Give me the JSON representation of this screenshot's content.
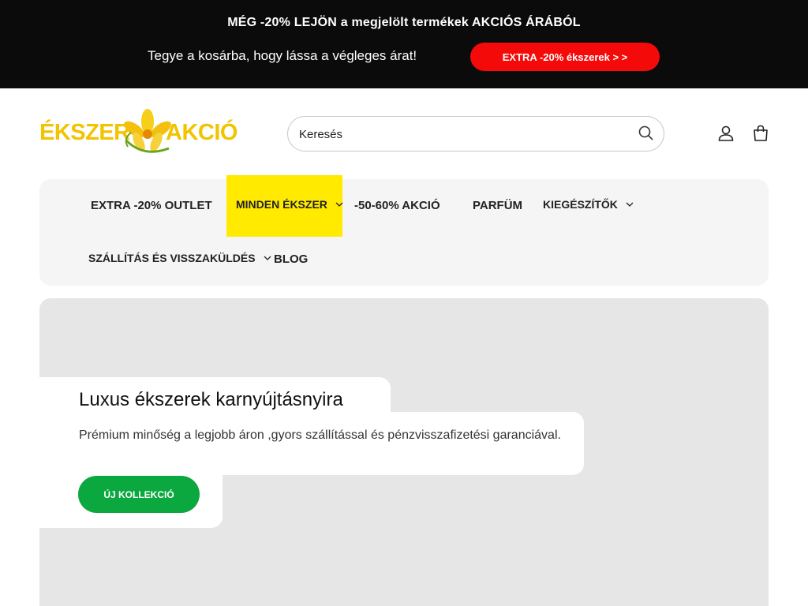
{
  "announcement": {
    "headline": "MÉG -20% LEJÖN a megjelölt termékek AKCIÓS ÁRÁBÓL",
    "subline": "Tegye a kosárba, hogy lássa a végleges árat!",
    "cta_label": "EXTRA -20% ékszerek > >",
    "cta_color": "#f50a0a"
  },
  "header": {
    "logo_left": "ÉKSZER",
    "logo_right": "AKCIÓ",
    "logo_color": "#f2c300",
    "search_placeholder": "Keresés"
  },
  "nav": {
    "items": [
      {
        "label": "EXTRA -20% OUTLET",
        "dropdown": false
      },
      {
        "label": "MINDEN ÉKSZER",
        "dropdown": true,
        "active": true
      },
      {
        "label": "-50-60% AKCIÓ",
        "dropdown": false
      },
      {
        "label": "PARFÜM",
        "dropdown": false
      },
      {
        "label": "KIEGÉSZÍTŐK",
        "dropdown": true
      },
      {
        "label": "SZÁLLÍTÁS ÉS VISSZAKÜLDÉS",
        "dropdown": true
      },
      {
        "label": "BLOG",
        "dropdown": false
      }
    ],
    "active_color": "#ffea00"
  },
  "hero": {
    "title": "Luxus ékszerek karnyújtásnyira",
    "subtitle": "Prémium minőség a legjobb áron ,gyors szállítással és pénzvisszafizetési garanciával.",
    "cta_label": "ÚJ KOLLEKCIÓ",
    "cta_color": "#0aa83f"
  }
}
